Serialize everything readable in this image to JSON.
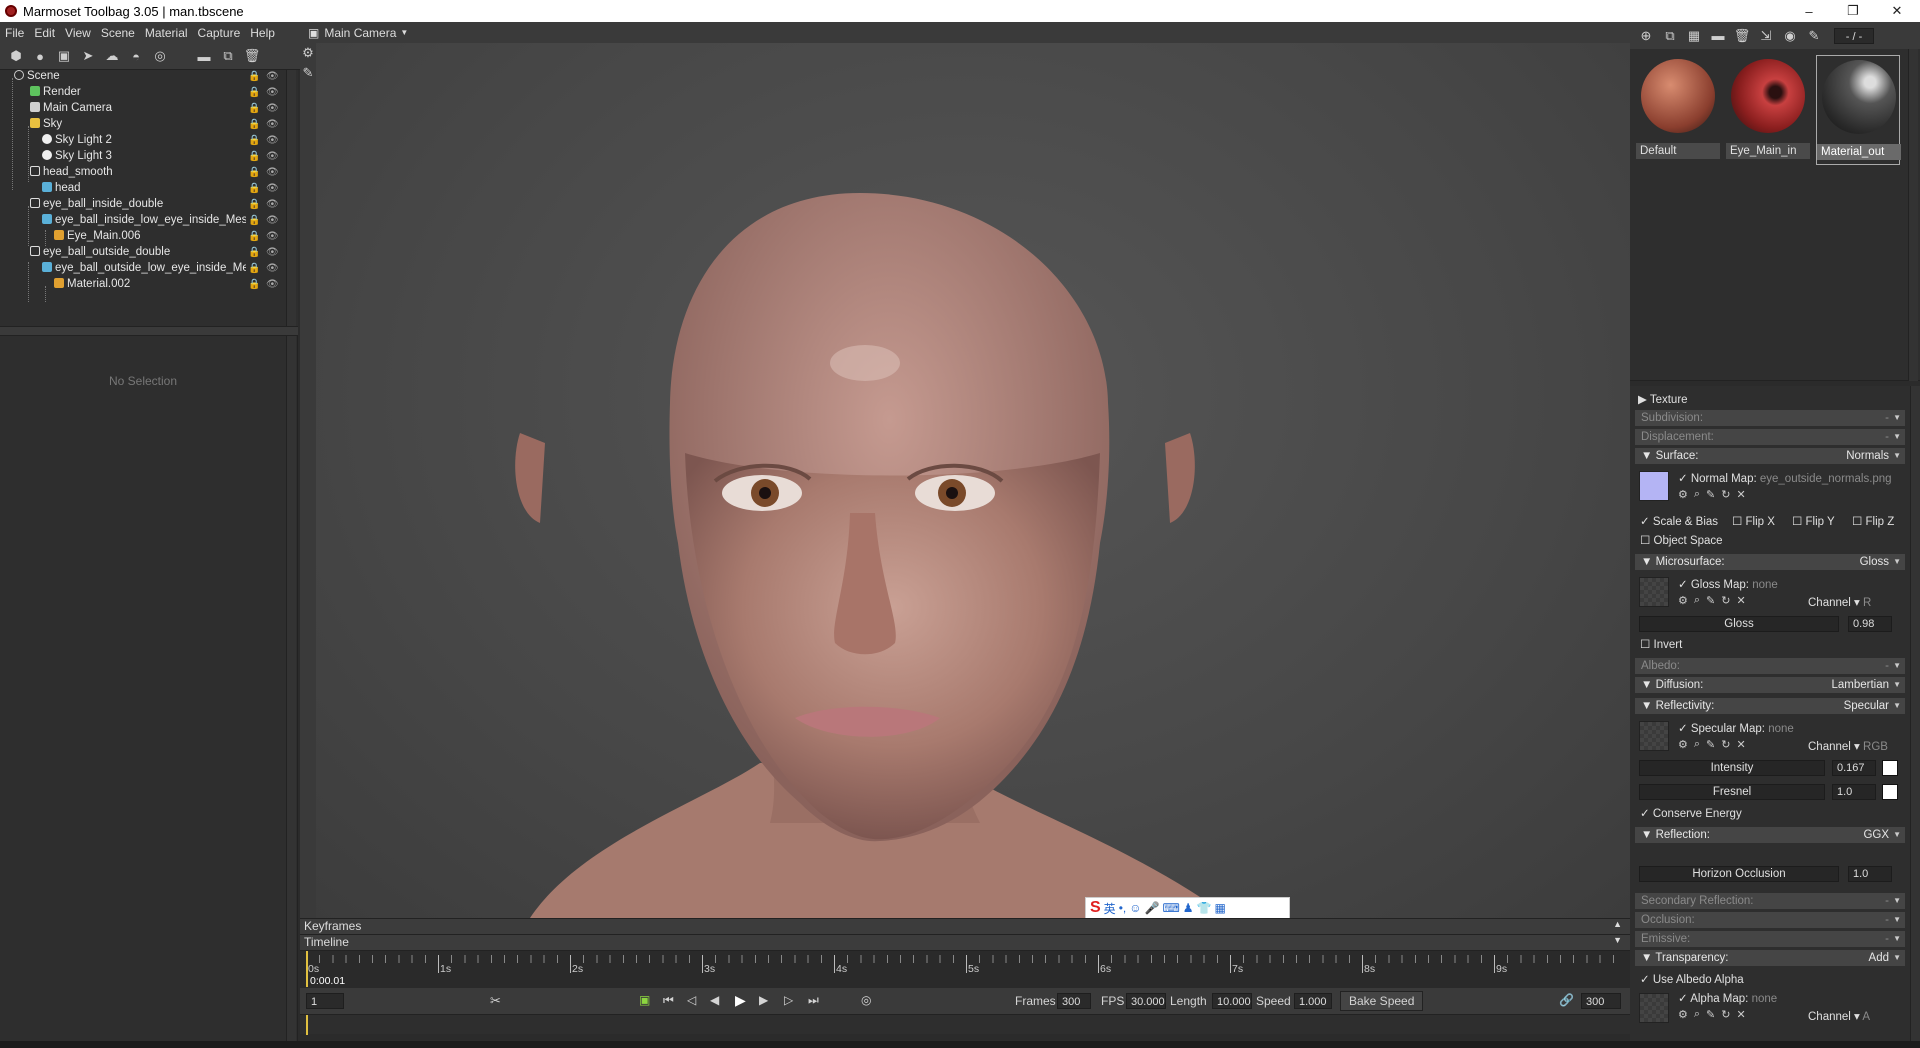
{
  "window": {
    "title": "Marmoset Toolbag 3.05  |  man.tbscene",
    "controls": [
      "–",
      "❐",
      "✕"
    ]
  },
  "menu": [
    "File",
    "Edit",
    "View",
    "Scene",
    "Material",
    "Capture",
    "Help"
  ],
  "scene_tree": [
    {
      "label": "Scene",
      "icon": "scene-icon",
      "color": "#cccccc"
    },
    {
      "label": "Render",
      "icon": "render-icon",
      "color": "#5ec35e"
    },
    {
      "label": "Main Camera",
      "icon": "camera-icon",
      "color": "#cfcfcf"
    },
    {
      "label": "Sky",
      "icon": "sky-icon",
      "color": "#e8c040"
    },
    {
      "label": "Sky Light 2",
      "icon": "light-bulb-icon",
      "color": "#f0f0f0"
    },
    {
      "label": "Sky Light 3",
      "icon": "light-bulb-icon",
      "color": "#f0f0f0"
    },
    {
      "label": "head_smooth",
      "icon": "object-icon",
      "color": "#dddddd"
    },
    {
      "label": "head",
      "icon": "mesh-icon",
      "color": "#5ab0d8"
    },
    {
      "label": "eye_ball_inside_double",
      "icon": "object-icon",
      "color": "#dddddd"
    },
    {
      "label": "eye_ball_inside_low_eye_inside_Mesl",
      "icon": "mesh-icon",
      "color": "#5ab0d8"
    },
    {
      "label": "Eye_Main.006",
      "icon": "material-icon",
      "color": "#e0a030"
    },
    {
      "label": "eye_ball_outside_double",
      "icon": "object-icon",
      "color": "#dddddd"
    },
    {
      "label": "eye_ball_outside_low_eye_inside_Me",
      "icon": "mesh-icon",
      "color": "#5ab0d8"
    },
    {
      "label": "Material.002",
      "icon": "material-icon",
      "color": "#e0a030"
    }
  ],
  "properties": {
    "empty_text": "No Selection"
  },
  "viewport": {
    "camera_label": "Main Camera"
  },
  "ime": {
    "label": "英"
  },
  "timeline": {
    "keyframes_label": "Keyframes",
    "timeline_label": "Timeline",
    "ticks": [
      "0s",
      "1s",
      "2s",
      "3s",
      "4s",
      "5s",
      "6s",
      "7s",
      "8s",
      "9s"
    ],
    "current_time": "0:00.01",
    "frame": "1",
    "frames_label": "Frames",
    "frames": "300",
    "fps_label": "FPS",
    "fps": "30.000",
    "length_label": "Length",
    "length": "10.000",
    "speed_label": "Speed",
    "speed": "1.000",
    "bake_speed": "Bake Speed",
    "end_frame": "300"
  },
  "material_toolbar": {
    "counter": "- / -"
  },
  "materials": [
    {
      "name": "Default",
      "color": "#b0604a",
      "selected": false
    },
    {
      "name": "Eye_Main_in",
      "color": "#b02a2a",
      "selected": false
    },
    {
      "name": "Material_out",
      "color": "#3a3a3a",
      "selected": true
    }
  ],
  "material_props": {
    "texture": "Texture",
    "subdivision": {
      "label": "Subdivision:",
      "value": "-"
    },
    "displacement": {
      "label": "Displacement:",
      "value": "-"
    },
    "surface": {
      "label": "Surface:",
      "value": "Normals"
    },
    "normal_map": {
      "label": "Normal Map:",
      "file": "eye_outside_normals.png"
    },
    "scale_bias": "Scale & Bias",
    "flip_x": "Flip X",
    "flip_y": "Flip Y",
    "flip_z": "Flip Z",
    "object_space": "Object Space",
    "microsurface": {
      "label": "Microsurface:",
      "value": "Gloss"
    },
    "gloss_map": {
      "label": "Gloss Map:",
      "file": "none"
    },
    "channel_label": "Channel",
    "gloss_channel": "R",
    "gloss": {
      "label": "Gloss",
      "value": "0.98"
    },
    "invert": "Invert",
    "albedo": {
      "label": "Albedo:",
      "value": "-"
    },
    "diffusion": {
      "label": "Diffusion:",
      "value": "Lambertian"
    },
    "reflectivity": {
      "label": "Reflectivity:",
      "value": "Specular"
    },
    "specular_map": {
      "label": "Specular Map:",
      "file": "none"
    },
    "specular_channel": "RGB",
    "intensity": {
      "label": "Intensity",
      "value": "0.167"
    },
    "fresnel": {
      "label": "Fresnel",
      "value": "1.0"
    },
    "conserve_energy": "Conserve Energy",
    "reflection": {
      "label": "Reflection:",
      "value": "GGX"
    },
    "horizon_occlusion": {
      "label": "Horizon Occlusion",
      "value": "1.0"
    },
    "secondary_reflection": {
      "label": "Secondary Reflection:",
      "value": "-"
    },
    "occlusion": {
      "label": "Occlusion:",
      "value": "-"
    },
    "emissive": {
      "label": "Emissive:",
      "value": "-"
    },
    "transparency": {
      "label": "Transparency:",
      "value": "Add"
    },
    "use_albedo_alpha": "Use Albedo Alpha",
    "alpha_map": {
      "label": "Alpha Map:",
      "file": "none"
    },
    "alpha_channel": "A"
  }
}
